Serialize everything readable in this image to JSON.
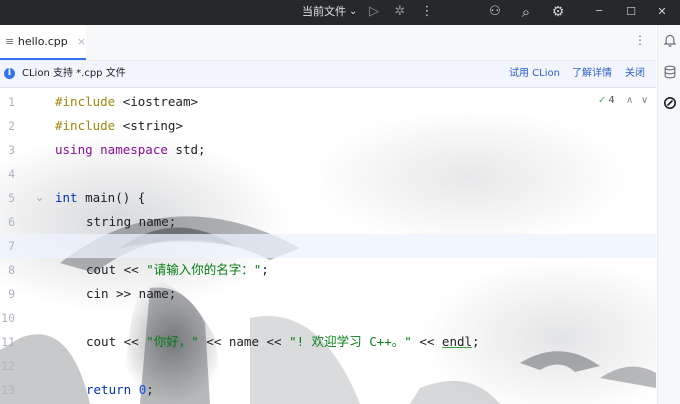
{
  "titlebar": {
    "run_config": "当前文件",
    "run_config_chevron": "⌄",
    "icons": [
      "run-icon",
      "debug-icon",
      "more-menu-icon",
      "add-user-icon",
      "search-icon",
      "settings-icon",
      "minimize-icon",
      "maximize-icon",
      "close-icon"
    ],
    "glyphs": {
      "run": "▷",
      "debug": "✲",
      "more": "⋮",
      "add_user": "⚇",
      "search": "⌕",
      "settings": "⚙",
      "minimize": "─",
      "maximize": "☐",
      "close": "✕"
    }
  },
  "tabs": [
    {
      "label": "hello.cpp",
      "active": true,
      "file_icon": "≡",
      "close": "×"
    }
  ],
  "tab_menu": "⋮",
  "notification": {
    "icon": "i",
    "text": "CLion 支持 *.cpp 文件",
    "actions": [
      "试用 CLion",
      "了解详情",
      "关闭"
    ]
  },
  "inspection": {
    "icon": "✓",
    "count": "4",
    "up": "∧",
    "down": "∨"
  },
  "sidebar": {
    "icons": [
      "notifications-icon",
      "database-icon",
      "ai-assistant-icon"
    ],
    "glyphs": [
      "🔔",
      "≋",
      "◎"
    ]
  },
  "editor": {
    "line_numbers": [
      "1",
      "2",
      "3",
      "4",
      "5",
      "6",
      "7",
      "8",
      "9",
      "10",
      "11",
      "12",
      "13"
    ],
    "fold_marker": "⌄",
    "current_line": 7,
    "lines": [
      [
        [
          "pp",
          "#include "
        ],
        [
          "",
          "<iostream>"
        ]
      ],
      [
        [
          "pp",
          "#include "
        ],
        [
          "",
          "<string>"
        ]
      ],
      [
        [
          "ns",
          "using namespace"
        ],
        [
          "",
          " std;"
        ]
      ],
      [],
      [
        [
          "kw",
          "int"
        ],
        [
          "",
          " main() {"
        ]
      ],
      [
        [
          "",
          "string name;"
        ]
      ],
      [],
      [
        [
          "",
          "cout << "
        ],
        [
          "str",
          "\"请输入你的名字：\""
        ],
        [
          "",
          ";"
        ]
      ],
      [
        [
          "",
          "cin >> name;"
        ]
      ],
      [],
      [
        [
          "",
          "cout << "
        ],
        [
          "str",
          "\"你好，\""
        ],
        [
          "",
          " << name << "
        ],
        [
          "str",
          "\"! 欢迎学习 C++。\""
        ],
        [
          "",
          " << "
        ],
        [
          "endl",
          "endl"
        ],
        [
          "",
          ";"
        ]
      ],
      [],
      [
        [
          "kw",
          "return"
        ],
        [
          "",
          " "
        ],
        [
          "num",
          "0"
        ],
        [
          "",
          ";"
        ]
      ]
    ]
  },
  "colors": {
    "titlebar": "#27282c",
    "accent": "#3574f0",
    "keyword": "#0033b3",
    "preprocessor": "#9e880d",
    "namespace": "#871094",
    "string": "#067d17",
    "number": "#1750eb"
  }
}
